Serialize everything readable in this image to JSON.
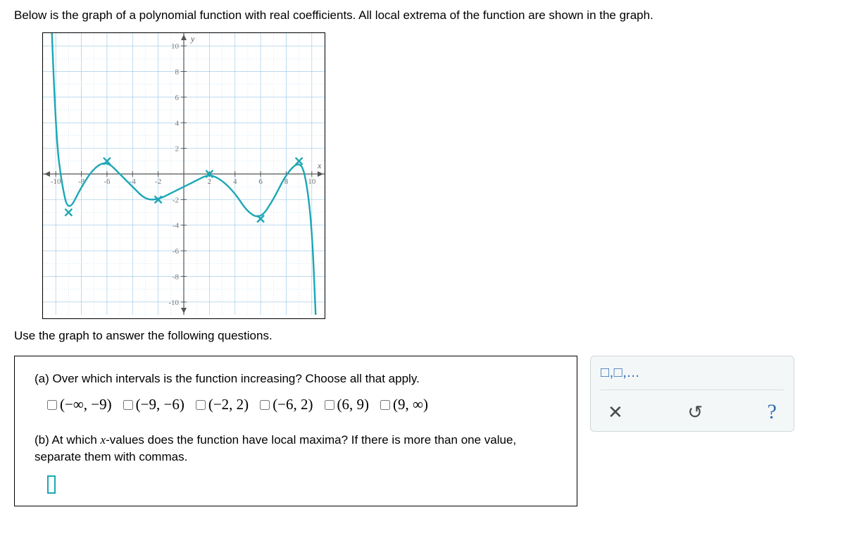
{
  "intro": "Below is the graph of a polynomial function with real coefficients. All local extrema of the function are shown in the graph.",
  "subtitle": "Use the graph to answer the following questions.",
  "part_a": {
    "prompt": "(a) Over which intervals is the function increasing? Choose all that apply.",
    "choices": [
      "(−∞, −9)",
      "(−9, −6)",
      "(−2, 2)",
      "(−6, 2)",
      "(6, 9)",
      "(9, ∞)"
    ]
  },
  "part_b": {
    "prompt": "(b) At which x-values does the function have local maxima? If there is more than one value, separate them with commas."
  },
  "toolbox": {
    "hint": "□,□,...",
    "clear": "✕",
    "reset": "↺",
    "help": "?"
  },
  "chart_data": {
    "type": "line",
    "title": "",
    "xlabel": "x",
    "ylabel": "y",
    "xlim": [
      -11,
      11
    ],
    "ylim": [
      -11,
      11
    ],
    "x_ticks": [
      -10,
      -8,
      -6,
      -4,
      -2,
      2,
      4,
      6,
      8,
      10
    ],
    "y_ticks": [
      -10,
      -8,
      -6,
      -4,
      -2,
      2,
      4,
      6,
      8,
      10
    ],
    "series": [
      {
        "name": "polynomial",
        "color": "#1ba7b5",
        "points": [
          [
            -10.3,
            11
          ],
          [
            -10,
            3
          ],
          [
            -9.5,
            -1
          ],
          [
            -9,
            -3
          ],
          [
            -8,
            -1
          ],
          [
            -7,
            0.5
          ],
          [
            -6,
            1
          ],
          [
            -5,
            0
          ],
          [
            -4,
            -1
          ],
          [
            -3,
            -2
          ],
          [
            -2,
            -2
          ],
          [
            -1,
            -1.5
          ],
          [
            0,
            -1
          ],
          [
            1,
            -0.5
          ],
          [
            2,
            0
          ],
          [
            3,
            -0.5
          ],
          [
            4,
            -1.5
          ],
          [
            5,
            -3
          ],
          [
            6,
            -3.5
          ],
          [
            7,
            -2
          ],
          [
            8,
            0
          ],
          [
            9,
            1
          ],
          [
            9.5,
            0
          ],
          [
            10,
            -4
          ],
          [
            10.3,
            -11
          ]
        ]
      }
    ],
    "marked_points": [
      [
        -9,
        -3
      ],
      [
        -6,
        1
      ],
      [
        -2,
        -2
      ],
      [
        2,
        0
      ],
      [
        6,
        -3.5
      ],
      [
        9,
        1
      ]
    ]
  }
}
